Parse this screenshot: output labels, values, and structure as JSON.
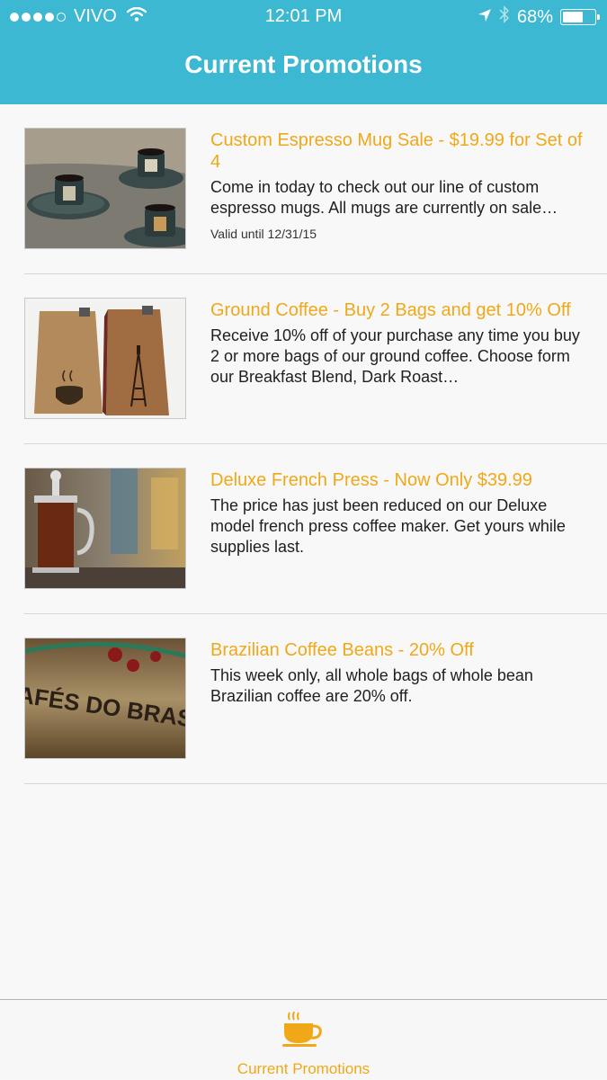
{
  "status_bar": {
    "carrier": "VIVO",
    "time": "12:01 PM",
    "battery_percent": "68%",
    "battery_level": 0.68,
    "signal_bars_filled": 4,
    "signal_bars_total": 5
  },
  "nav": {
    "title": "Current Promotions"
  },
  "colors": {
    "accent": "#f0a818",
    "header": "#3db8d2"
  },
  "promotions": [
    {
      "title": "Custom Espresso Mug Sale - $19.99 for Set of 4",
      "description": "Come in today to check out our line of custom espresso mugs. All mugs are currently on sale…",
      "valid_until": "Valid until 12/31/15",
      "image": "espresso-mugs-image"
    },
    {
      "title": "Ground Coffee - Buy 2 Bags and get 10% Off",
      "description": "Receive 10% off of your purchase any time you buy 2 or more bags of our ground coffee. Choose form our Breakfast Blend, Dark Roast…",
      "image": "coffee-bags-image"
    },
    {
      "title": "Deluxe French Press - Now Only $39.99",
      "description": "The price has just been reduced on our Deluxe model french press coffee maker. Get yours while supplies last.",
      "image": "french-press-image"
    },
    {
      "title": "Brazilian Coffee Beans - 20% Off",
      "description": "This week only, all whole bags of whole bean Brazilian coffee are 20% off.",
      "image": "brazilian-coffee-sack-image",
      "image_text": "CAFÉS DO BRASIL"
    }
  ],
  "tab_bar": {
    "items": [
      {
        "label": "Current Promotions",
        "icon": "coffee-cup-icon",
        "selected": true
      }
    ]
  }
}
